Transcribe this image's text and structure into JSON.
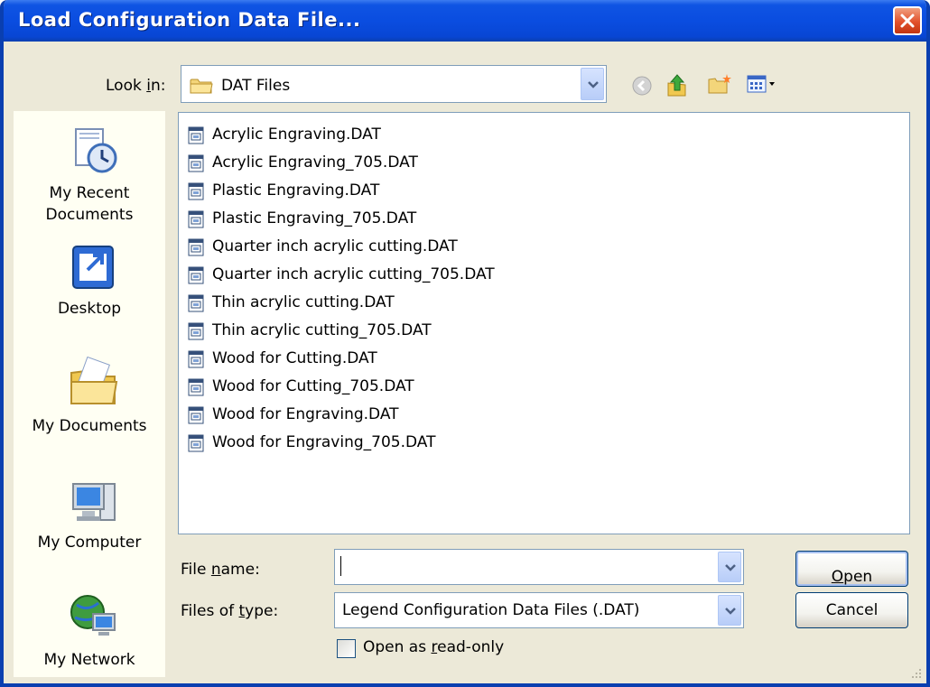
{
  "window": {
    "title": "Load Configuration Data File..."
  },
  "look_in": {
    "label_pre": "Look ",
    "label_hot": "i",
    "label_post": "n:",
    "value": "DAT Files"
  },
  "toolbar": {
    "icons": [
      "back-icon",
      "up-folder-icon",
      "new-folder-icon",
      "views-menu-icon"
    ]
  },
  "places": [
    {
      "icon": "recent-documents-icon",
      "line1": "My Recent",
      "line2": "Documents"
    },
    {
      "icon": "desktop-icon",
      "line1": "Desktop",
      "line2": ""
    },
    {
      "icon": "my-documents-icon",
      "line1": "My Documents",
      "line2": ""
    },
    {
      "icon": "my-computer-icon",
      "line1": "My Computer",
      "line2": ""
    },
    {
      "icon": "my-network-icon",
      "line1": "My Network",
      "line2": ""
    }
  ],
  "files": [
    "Acrylic Engraving.DAT",
    "Acrylic Engraving_705.DAT",
    "Plastic Engraving.DAT",
    "Plastic Engraving_705.DAT",
    "Quarter inch acrylic cutting.DAT",
    "Quarter inch acrylic cutting_705.DAT",
    "Thin acrylic cutting.DAT",
    "Thin acrylic cutting_705.DAT",
    "Wood for Cutting.DAT",
    "Wood for Cutting_705.DAT",
    "Wood for Engraving.DAT",
    "Wood for Engraving_705.DAT"
  ],
  "file_name": {
    "label_pre": "File ",
    "label_hot": "n",
    "label_post": "ame:",
    "value": ""
  },
  "file_type": {
    "label_pre": "Files of ",
    "label_hot": "t",
    "label_post": "ype:",
    "value": "Legend Configuration Data Files (.DAT)"
  },
  "read_only": {
    "label_pre": "Open as ",
    "label_hot": "r",
    "label_post": "ead-only",
    "checked": false
  },
  "buttons": {
    "open_hot": "O",
    "open_rest": "pen",
    "cancel": "Cancel"
  },
  "colors": {
    "titlebar": "#0a4de0",
    "dialog_bg": "#ece9d8",
    "places_bg": "#fffff3",
    "border": "#7f9db9"
  }
}
